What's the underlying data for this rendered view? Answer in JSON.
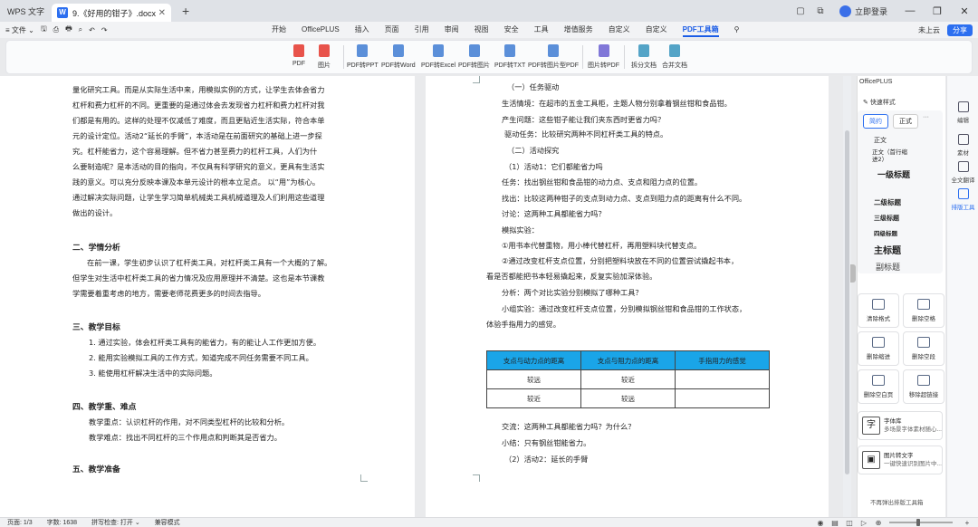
{
  "titlebar": {
    "app_name": "WPS 文字",
    "tab_title": "9.《好用的钳子》.docx",
    "tab_close": "✕",
    "new_tab": "+",
    "login": "立即登录"
  },
  "menubar": {
    "file_menu": "≡ 文件 ⌄",
    "tabs": [
      "开始",
      "OfficePLUS",
      "插入",
      "页面",
      "引用",
      "审阅",
      "视图",
      "安全",
      "工具",
      "增值服务",
      "自定义",
      "自定义",
      "PDF工具箱"
    ],
    "active_tab": "PDF工具箱",
    "upload": "未上云",
    "share": "分享"
  },
  "ribbon": {
    "buttons": [
      "PDF",
      "图片",
      "PDF转PPT",
      "PDF转Word",
      "PDF转Excel",
      "PDF转图片",
      "PDF转TXT",
      "PDF转图片型PDF",
      "图片转PDF",
      "拆分文档",
      "合并文档"
    ]
  },
  "page_left": {
    "lines": [
      "量化研究工具。而是从实际生活中来，用模拟实例的方式，让学生去体会省力",
      "杠杆和费力杠杆的不同。更重要的是通过体会去发现省力杠杆和费力杠杆对我",
      "们都是有用的。这样的处理不仅减低了难度，而且更贴近生活实际，符合本单",
      "元的设计定位。活动2“延长的手臂”，本活动是在前面研究的基础上进一步探",
      "究。杠杆能省力，这个容易理解。但不省力甚至费力的杠杆工具，人们为什",
      "么要制造呢？是本活动的目的指向，不仅具有科学研究的意义，更具有生活实",
      "践的意义。可以充分反映本课及本单元设计的根本立足点。 以“用”为核心。",
      "通过解决实际问题，让学生学习简单机械类工具机械道理及人们利用这些道理",
      "做出的设计。"
    ],
    "h2": "二、学情分析",
    "s2": [
      "在前一课，学生初步认识了杠杆类工具，对杠杆类工具有一个大概的了解。",
      "但学生对生活中杠杆类工具的省力情况及应用原理并不清楚。这也是本节课教",
      "学需要着重考虑的地方，需要老师花费更多的时间去指导。"
    ],
    "h3": "三、教学目标",
    "s3": [
      "1. 通过实验，体会杠杆类工具有的能省力，有的能让人工作更加方便。",
      "2. 能用实验模拟工具的工作方式，知道完成不同任务需要不同工具。",
      "3. 能使用杠杆解决生活中的实际问题。"
    ],
    "h4": "四、教学重、难点",
    "s4": [
      "教学重点：认识杠杆的作用，对不同类型杠杆的比较和分析。",
      "教学难点：找出不同杠杆的三个作用点和判断其是否省力。"
    ],
    "h5": "五、教学准备"
  },
  "page_right": {
    "lines": [
      "（一）任务驱动",
      "生活情境：在超市的五金工具柜，主题人物分别拿着钢丝钳和食品钳。",
      "产生问题：这些钳子能让我们夹东西时更省力吗？",
      "驱动任务：比较研究两种不同杠杆类工具的特点。",
      "（二）活动探究",
      "（1）活动1：它们都能省力吗",
      "任务：找出钢丝钳和食品钳的动力点、支点和阻力点的位置。",
      "找出：比较这两种钳子的支点到动力点、支点到阻力点的距离有什么不同。",
      "讨论：这两种工具都能省力吗？",
      "模拟实验：",
      "①用书本代替重物，用小棒代替杠杆，再用塑料块代替支点。",
      "②通过改变杠杆支点位置，分别把塑料块放在不同的位置尝试撬起书本，",
      "看是否都能把书本轻易撬起来，反复实验加深体验。",
      "分析：两个对比实验分别模拟了哪种工具？",
      "小组实验：通过改变杠杆支点位置，分别模拟钢丝钳和食品钳的工作状态，",
      "体验手指用力的感觉。"
    ],
    "table": {
      "headers": [
        "支点与动力点的距离",
        "支点与阻力点的距离",
        "手指用力的感觉"
      ],
      "rows": [
        [
          "较远",
          "较近",
          ""
        ],
        [
          "较近",
          "较远",
          ""
        ]
      ]
    },
    "after": [
      "交流：这两种工具都能省力吗？为什么？",
      "小结：只有钢丝钳能省力。",
      "（2）活动2：延长的手臂"
    ]
  },
  "panel": {
    "title": "OfficePLUS",
    "quick_style": "快速样式",
    "tab_simple": "简约",
    "tab_formal": "正式",
    "more": "···",
    "styles": [
      "正文",
      "正文（首行缩进2）",
      "一级标题",
      "二级标题",
      "三级标题",
      "四级标题",
      "主标题",
      "副标题"
    ],
    "tools": [
      "清除格式",
      "删除空格",
      "删除缩进",
      "删除空段",
      "删除空白页",
      "移除超链接"
    ],
    "card1_title": "字体库",
    "card1_sub": "多场景字体素材随心...",
    "card2_title": "图片转文字",
    "card2_sub": "一键快速识别图片中...",
    "footer": "不再弹出排版工具箱"
  },
  "rail": {
    "items": [
      "编辑",
      "素材",
      "全文翻译",
      "排版工具"
    ],
    "active": "排版工具"
  },
  "statusbar": {
    "page": "页面: 1/3",
    "words": "字数: 1638",
    "spell": "拼写检查: 打开 ⌄",
    "compat": "兼容模式"
  }
}
